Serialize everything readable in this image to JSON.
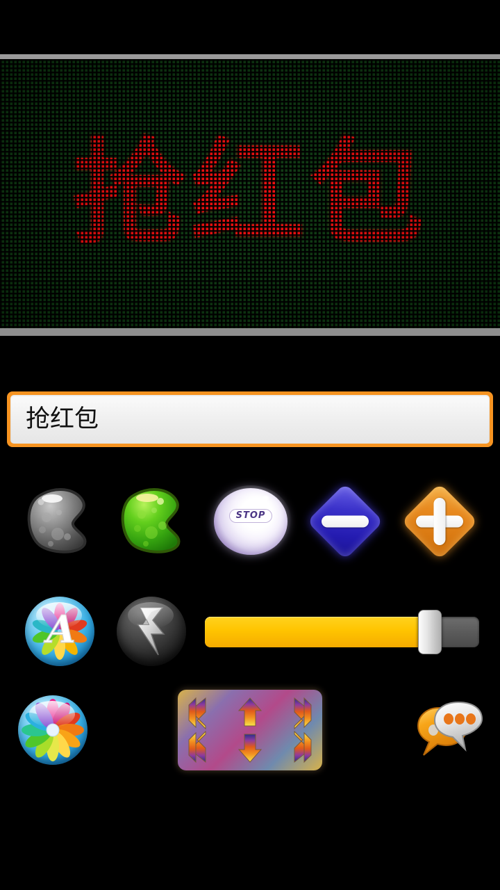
{
  "app": {
    "background_color": "#000000",
    "accent_color": "#f79421"
  },
  "led_display": {
    "name": "led-marquee-preview",
    "text": "抢红包",
    "text_color": "#f40a0a",
    "background_color": "#0c3a10",
    "frame_color": "#9a9a9a",
    "grid_color": "#000000"
  },
  "text_input": {
    "name": "marquee-text-input",
    "value": "抢红包",
    "placeholder": "抢红包",
    "border_color": "#f79421"
  },
  "row1": {
    "buttons": [
      {
        "name": "blob-grey-button",
        "label": "",
        "color": "#808080"
      },
      {
        "name": "blob-green-button",
        "label": "",
        "color": "#3fbf1f"
      },
      {
        "name": "stop-button",
        "label": "STOP",
        "color": "#8b77b3"
      },
      {
        "name": "minus-button",
        "label": "−",
        "color": "#241bb0"
      },
      {
        "name": "plus-button",
        "label": "+",
        "color": "#d97912"
      }
    ]
  },
  "row2": {
    "buttons": [
      {
        "name": "font-style-button",
        "label": "A",
        "color": "#36aee4"
      },
      {
        "name": "flash-speed-button",
        "label": "",
        "color": "#2a2a2a"
      }
    ],
    "slider": {
      "name": "speed-slider",
      "value": 82,
      "min": 0,
      "max": 100,
      "fill_color": "#ffc400",
      "track_color": "#5b5b5b",
      "thumb_color": "#e3e3e3"
    }
  },
  "row3": {
    "buttons": [
      {
        "name": "color-picker-button",
        "label": "",
        "color": "#36aee4"
      },
      {
        "name": "direction-pad",
        "label": "",
        "color": "#c07a60"
      },
      {
        "name": "chat-button",
        "label": "",
        "color": "#f0a030"
      }
    ],
    "direction_pad": {
      "name": "scroll-direction-pad",
      "arrows": [
        "up-left",
        "up",
        "up-right",
        "down-left",
        "down",
        "down-right"
      ]
    },
    "chat": {
      "name": "chat-bubbles-icon",
      "dot_count": 3
    }
  }
}
